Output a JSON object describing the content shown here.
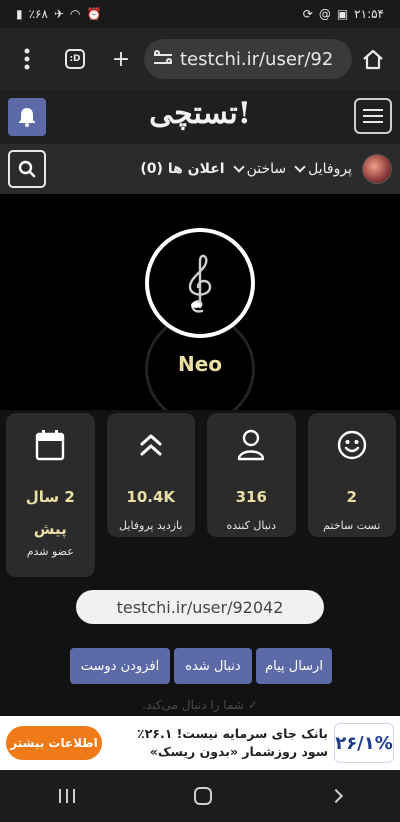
{
  "status_bar": {
    "time": "۲۱:۵۴",
    "battery": "٪۶۸"
  },
  "browser": {
    "url": "testchi.ir/user/92",
    "tabs_count": ":D"
  },
  "site": {
    "logo": "تستچی!",
    "accent_color": "#5d6aa8",
    "nav": {
      "profile_label": "پروفایل",
      "build_label": "ساختن",
      "notifications_label": "اعلان ها (0)"
    }
  },
  "profile": {
    "username": "Neo",
    "stats": [
      {
        "icon": "smiley-icon",
        "value": "2",
        "label": "تست ساختم"
      },
      {
        "icon": "user-icon",
        "value": "316",
        "label": "دنبال کننده"
      },
      {
        "icon": "double-chevron-up-icon",
        "value": "10.4K",
        "label": "بازدید پروفایل"
      },
      {
        "icon": "calendar-icon",
        "value": "2 سال پیش",
        "label": "عضو شدم"
      }
    ],
    "profile_url": "testchi.ir/user/92042",
    "actions": {
      "message": "ارسال پیام",
      "followed": "دنبال شده",
      "add_friend": "افزودن دوست"
    },
    "follow_note": "✓ شما را دنبال می‌کند."
  },
  "ad": {
    "line1": "بانک جای سرمایه نیست! ۲۶.۱٪",
    "line2": "سود روزشمار «بدون ریسک»",
    "cta": "اطلاعات بیشتر",
    "badge": "۲۶/۱%"
  }
}
